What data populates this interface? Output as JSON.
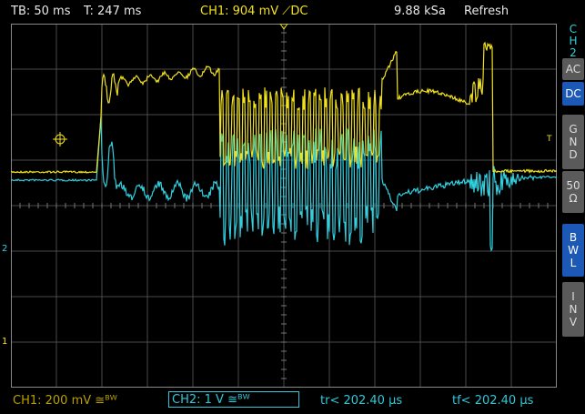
{
  "header": {
    "timebase": "TB: 50 ms",
    "trigger_time": "T: 247 ms",
    "ch1_trigger": "CH1: 904 mV ⟋DC",
    "sample_rate": "9.88 kSa",
    "acq_mode": "Refresh"
  },
  "side_panel": {
    "channel_label": "C H 2",
    "buttons": [
      {
        "label": "AC",
        "active": false
      },
      {
        "label": "DC",
        "active": true
      },
      {
        "label": "G N D",
        "active": false
      },
      {
        "label": "50 Ω",
        "active": false
      },
      {
        "label": "B W L",
        "active": true
      },
      {
        "label": "I N V",
        "active": false
      }
    ]
  },
  "footer": {
    "ch1_scale": "CH1: 200 mV ≅ᴮᵂ",
    "ch2_scale": "CH2: 1 V ≅ᴮᵂ",
    "rise_time": "tr< 202.40 µs",
    "fall_time": "tf< 202.40 µs"
  },
  "markers": {
    "ch1": "1",
    "ch2": "2",
    "trigger_level": "T"
  },
  "colors": {
    "ch1": "#f0e020",
    "ch2": "#30d0e0",
    "grid": "#555555",
    "active_button": "#1c58b5"
  }
}
